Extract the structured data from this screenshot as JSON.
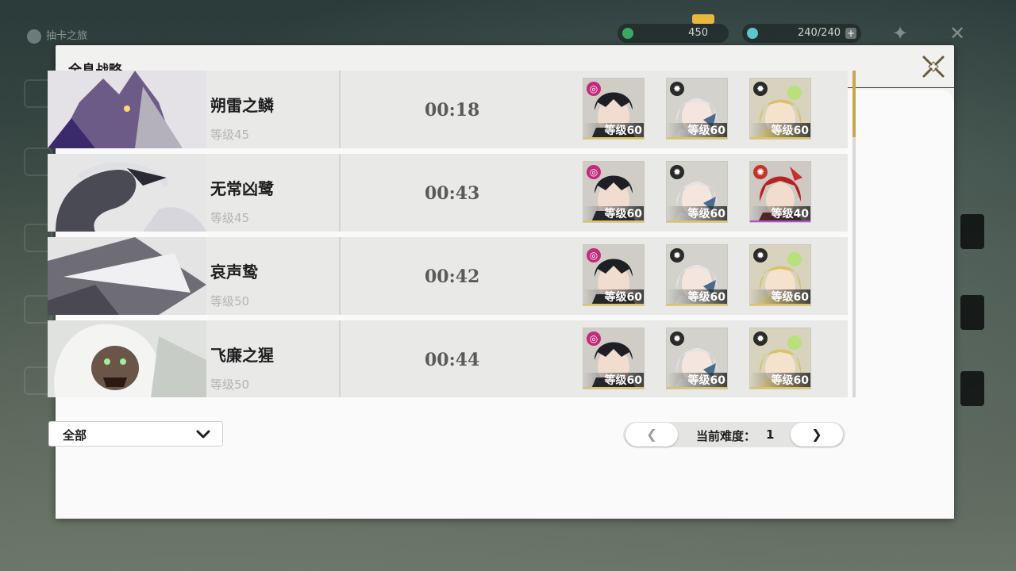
{
  "background": {
    "top_left_label": "抽卡之旅",
    "currency1": "450",
    "currency2": "240/240"
  },
  "panel": {
    "title": "全息战略"
  },
  "rows": [
    {
      "name": "朔雷之鳞",
      "level": "等级45",
      "time": "00:18",
      "team": [
        {
          "elem": "spiral",
          "level": "等级60",
          "rarity": "gold",
          "face": "dark-hair"
        },
        {
          "elem": "sun",
          "level": "等级60",
          "rarity": "gold",
          "face": "silver-hair"
        },
        {
          "elem": "sun",
          "level": "等级60",
          "rarity": "gold",
          "face": "blonde-hair"
        }
      ]
    },
    {
      "name": "无常凶鹭",
      "level": "等级45",
      "time": "00:43",
      "team": [
        {
          "elem": "spiral",
          "level": "等级60",
          "rarity": "gold",
          "face": "dark-hair"
        },
        {
          "elem": "sun",
          "level": "等级60",
          "rarity": "gold",
          "face": "silver-hair"
        },
        {
          "elem": "flame",
          "level": "等级40",
          "rarity": "purple",
          "face": "red-hair"
        }
      ]
    },
    {
      "name": "哀声鸷",
      "level": "等级50",
      "time": "00:42",
      "team": [
        {
          "elem": "spiral",
          "level": "等级60",
          "rarity": "gold",
          "face": "dark-hair"
        },
        {
          "elem": "sun",
          "level": "等级60",
          "rarity": "gold",
          "face": "silver-hair"
        },
        {
          "elem": "sun",
          "level": "等级60",
          "rarity": "gold",
          "face": "blonde-hair"
        }
      ]
    },
    {
      "name": "飞廉之猩",
      "level": "等级50",
      "time": "00:44",
      "team": [
        {
          "elem": "spiral",
          "level": "等级60",
          "rarity": "gold",
          "face": "dark-hair"
        },
        {
          "elem": "sun",
          "level": "等级60",
          "rarity": "gold",
          "face": "silver-hair"
        },
        {
          "elem": "sun",
          "level": "等级60",
          "rarity": "gold",
          "face": "blonde-hair"
        }
      ]
    }
  ],
  "filter": {
    "selected": "全部"
  },
  "difficulty": {
    "label": "当前难度：",
    "value": "1",
    "prev": "❮",
    "next": "❯"
  },
  "colors": {
    "accent_gold": "#c8a64c",
    "rarity_gold": "#e1c35a",
    "rarity_purple": "#b24bd6"
  }
}
